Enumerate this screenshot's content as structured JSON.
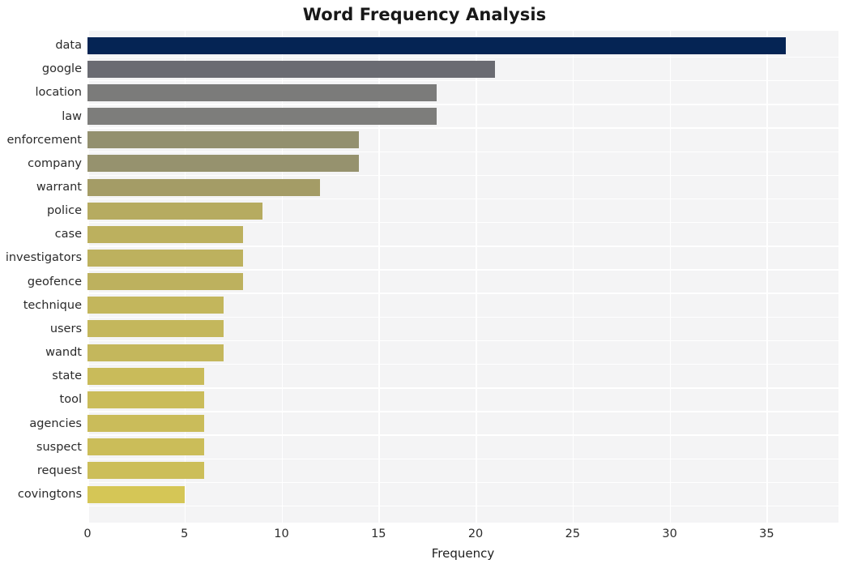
{
  "chart_data": {
    "type": "bar",
    "orientation": "horizontal",
    "title": "Word Frequency Analysis",
    "xlabel": "Frequency",
    "ylabel": "",
    "categories": [
      "data",
      "google",
      "location",
      "law",
      "enforcement",
      "company",
      "warrant",
      "police",
      "case",
      "investigators",
      "geofence",
      "technique",
      "users",
      "wandt",
      "state",
      "tool",
      "agencies",
      "suspect",
      "request",
      "covingtons"
    ],
    "values": [
      36,
      21,
      18,
      18,
      14,
      14,
      12,
      9,
      8,
      8,
      8,
      7,
      7,
      7,
      6,
      6,
      6,
      6,
      6,
      5
    ],
    "xticks": [
      0,
      5,
      10,
      15,
      20,
      25,
      30,
      35
    ],
    "xtick_labels": [
      "0",
      "5",
      "10",
      "15",
      "20",
      "25",
      "30",
      "35"
    ],
    "xlim": [
      0,
      38.7
    ],
    "grid": true,
    "legend": null,
    "bar_colors": [
      "#052454",
      "#6a6b72",
      "#7b7b7a",
      "#7d7d7b",
      "#93906f",
      "#96926e",
      "#a49c66",
      "#b6ab60",
      "#bcb05e",
      "#bdb15e",
      "#bdb15e",
      "#c3b65c",
      "#c4b75c",
      "#c4b75c",
      "#c9bb5a",
      "#cabc5a",
      "#cabc5a",
      "#cbbd59",
      "#ccbe59",
      "#d5c656"
    ],
    "plot_bgcolor": "#f4f4f5",
    "gridline_color": "#ffffff",
    "figure_bgcolor": "#ffffff"
  }
}
